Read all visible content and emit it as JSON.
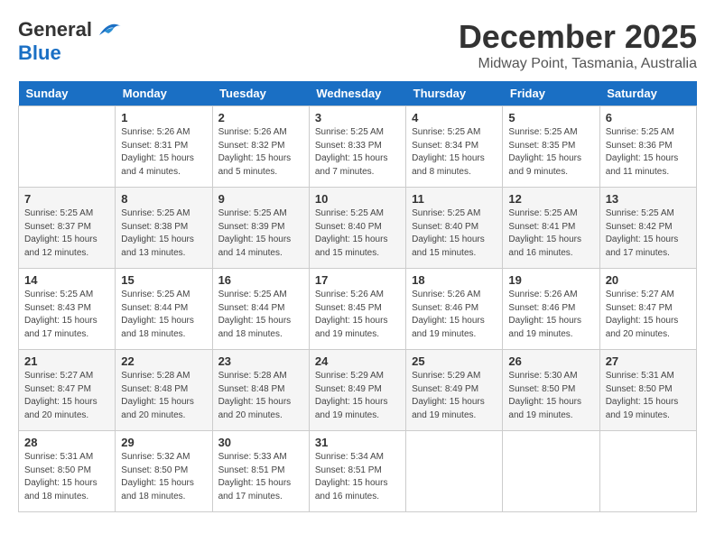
{
  "header": {
    "logo_general": "General",
    "logo_blue": "Blue",
    "month": "December 2025",
    "location": "Midway Point, Tasmania, Australia"
  },
  "days_of_week": [
    "Sunday",
    "Monday",
    "Tuesday",
    "Wednesday",
    "Thursday",
    "Friday",
    "Saturday"
  ],
  "weeks": [
    [
      {
        "day": "",
        "sunrise": "",
        "sunset": "",
        "daylight": ""
      },
      {
        "day": "1",
        "sunrise": "Sunrise: 5:26 AM",
        "sunset": "Sunset: 8:31 PM",
        "daylight": "Daylight: 15 hours and 4 minutes."
      },
      {
        "day": "2",
        "sunrise": "Sunrise: 5:26 AM",
        "sunset": "Sunset: 8:32 PM",
        "daylight": "Daylight: 15 hours and 5 minutes."
      },
      {
        "day": "3",
        "sunrise": "Sunrise: 5:25 AM",
        "sunset": "Sunset: 8:33 PM",
        "daylight": "Daylight: 15 hours and 7 minutes."
      },
      {
        "day": "4",
        "sunrise": "Sunrise: 5:25 AM",
        "sunset": "Sunset: 8:34 PM",
        "daylight": "Daylight: 15 hours and 8 minutes."
      },
      {
        "day": "5",
        "sunrise": "Sunrise: 5:25 AM",
        "sunset": "Sunset: 8:35 PM",
        "daylight": "Daylight: 15 hours and 9 minutes."
      },
      {
        "day": "6",
        "sunrise": "Sunrise: 5:25 AM",
        "sunset": "Sunset: 8:36 PM",
        "daylight": "Daylight: 15 hours and 11 minutes."
      }
    ],
    [
      {
        "day": "7",
        "sunrise": "Sunrise: 5:25 AM",
        "sunset": "Sunset: 8:37 PM",
        "daylight": "Daylight: 15 hours and 12 minutes."
      },
      {
        "day": "8",
        "sunrise": "Sunrise: 5:25 AM",
        "sunset": "Sunset: 8:38 PM",
        "daylight": "Daylight: 15 hours and 13 minutes."
      },
      {
        "day": "9",
        "sunrise": "Sunrise: 5:25 AM",
        "sunset": "Sunset: 8:39 PM",
        "daylight": "Daylight: 15 hours and 14 minutes."
      },
      {
        "day": "10",
        "sunrise": "Sunrise: 5:25 AM",
        "sunset": "Sunset: 8:40 PM",
        "daylight": "Daylight: 15 hours and 15 minutes."
      },
      {
        "day": "11",
        "sunrise": "Sunrise: 5:25 AM",
        "sunset": "Sunset: 8:40 PM",
        "daylight": "Daylight: 15 hours and 15 minutes."
      },
      {
        "day": "12",
        "sunrise": "Sunrise: 5:25 AM",
        "sunset": "Sunset: 8:41 PM",
        "daylight": "Daylight: 15 hours and 16 minutes."
      },
      {
        "day": "13",
        "sunrise": "Sunrise: 5:25 AM",
        "sunset": "Sunset: 8:42 PM",
        "daylight": "Daylight: 15 hours and 17 minutes."
      }
    ],
    [
      {
        "day": "14",
        "sunrise": "Sunrise: 5:25 AM",
        "sunset": "Sunset: 8:43 PM",
        "daylight": "Daylight: 15 hours and 17 minutes."
      },
      {
        "day": "15",
        "sunrise": "Sunrise: 5:25 AM",
        "sunset": "Sunset: 8:44 PM",
        "daylight": "Daylight: 15 hours and 18 minutes."
      },
      {
        "day": "16",
        "sunrise": "Sunrise: 5:25 AM",
        "sunset": "Sunset: 8:44 PM",
        "daylight": "Daylight: 15 hours and 18 minutes."
      },
      {
        "day": "17",
        "sunrise": "Sunrise: 5:26 AM",
        "sunset": "Sunset: 8:45 PM",
        "daylight": "Daylight: 15 hours and 19 minutes."
      },
      {
        "day": "18",
        "sunrise": "Sunrise: 5:26 AM",
        "sunset": "Sunset: 8:46 PM",
        "daylight": "Daylight: 15 hours and 19 minutes."
      },
      {
        "day": "19",
        "sunrise": "Sunrise: 5:26 AM",
        "sunset": "Sunset: 8:46 PM",
        "daylight": "Daylight: 15 hours and 19 minutes."
      },
      {
        "day": "20",
        "sunrise": "Sunrise: 5:27 AM",
        "sunset": "Sunset: 8:47 PM",
        "daylight": "Daylight: 15 hours and 20 minutes."
      }
    ],
    [
      {
        "day": "21",
        "sunrise": "Sunrise: 5:27 AM",
        "sunset": "Sunset: 8:47 PM",
        "daylight": "Daylight: 15 hours and 20 minutes."
      },
      {
        "day": "22",
        "sunrise": "Sunrise: 5:28 AM",
        "sunset": "Sunset: 8:48 PM",
        "daylight": "Daylight: 15 hours and 20 minutes."
      },
      {
        "day": "23",
        "sunrise": "Sunrise: 5:28 AM",
        "sunset": "Sunset: 8:48 PM",
        "daylight": "Daylight: 15 hours and 20 minutes."
      },
      {
        "day": "24",
        "sunrise": "Sunrise: 5:29 AM",
        "sunset": "Sunset: 8:49 PM",
        "daylight": "Daylight: 15 hours and 19 minutes."
      },
      {
        "day": "25",
        "sunrise": "Sunrise: 5:29 AM",
        "sunset": "Sunset: 8:49 PM",
        "daylight": "Daylight: 15 hours and 19 minutes."
      },
      {
        "day": "26",
        "sunrise": "Sunrise: 5:30 AM",
        "sunset": "Sunset: 8:50 PM",
        "daylight": "Daylight: 15 hours and 19 minutes."
      },
      {
        "day": "27",
        "sunrise": "Sunrise: 5:31 AM",
        "sunset": "Sunset: 8:50 PM",
        "daylight": "Daylight: 15 hours and 19 minutes."
      }
    ],
    [
      {
        "day": "28",
        "sunrise": "Sunrise: 5:31 AM",
        "sunset": "Sunset: 8:50 PM",
        "daylight": "Daylight: 15 hours and 18 minutes."
      },
      {
        "day": "29",
        "sunrise": "Sunrise: 5:32 AM",
        "sunset": "Sunset: 8:50 PM",
        "daylight": "Daylight: 15 hours and 18 minutes."
      },
      {
        "day": "30",
        "sunrise": "Sunrise: 5:33 AM",
        "sunset": "Sunset: 8:51 PM",
        "daylight": "Daylight: 15 hours and 17 minutes."
      },
      {
        "day": "31",
        "sunrise": "Sunrise: 5:34 AM",
        "sunset": "Sunset: 8:51 PM",
        "daylight": "Daylight: 15 hours and 16 minutes."
      },
      {
        "day": "",
        "sunrise": "",
        "sunset": "",
        "daylight": ""
      },
      {
        "day": "",
        "sunrise": "",
        "sunset": "",
        "daylight": ""
      },
      {
        "day": "",
        "sunrise": "",
        "sunset": "",
        "daylight": ""
      }
    ]
  ]
}
